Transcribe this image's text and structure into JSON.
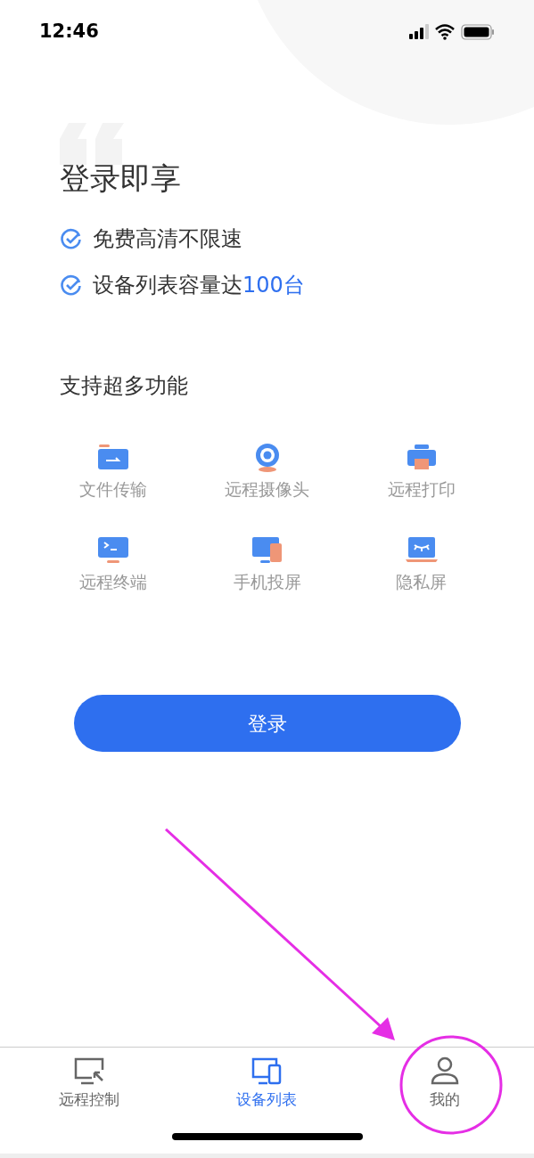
{
  "status_bar": {
    "time": "12:46"
  },
  "title": "登录即享",
  "benefits": [
    {
      "text": "免费高清不限速"
    },
    {
      "text": "设备列表容量达",
      "highlight": "100台"
    }
  ],
  "features_heading": "支持超多功能",
  "features": [
    {
      "kind": "file",
      "label": "文件传输"
    },
    {
      "kind": "camera",
      "label": "远程摄像头"
    },
    {
      "kind": "printer",
      "label": "远程打印"
    },
    {
      "kind": "terminal",
      "label": "远程终端"
    },
    {
      "kind": "mirror",
      "label": "手机投屏"
    },
    {
      "kind": "privacy",
      "label": "隐私屏"
    }
  ],
  "login_button": "登录",
  "tabs": [
    {
      "kind": "remote",
      "label": "远程控制",
      "selected": false
    },
    {
      "kind": "devices",
      "label": "设备列表",
      "selected": true
    },
    {
      "kind": "me",
      "label": "我的",
      "selected": false
    }
  ]
}
